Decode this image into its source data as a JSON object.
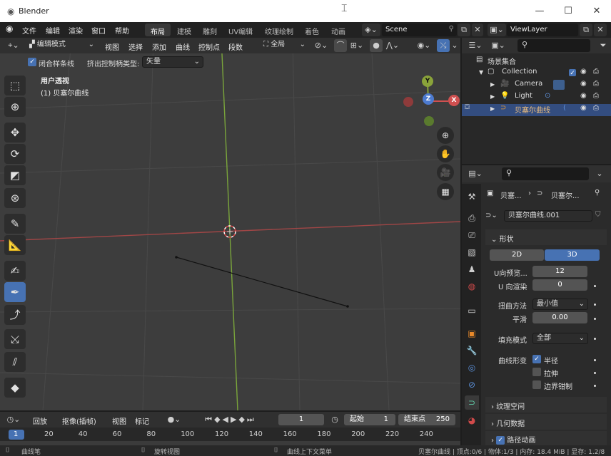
{
  "window": {
    "title": "Blender"
  },
  "menu": {
    "items": [
      "文件",
      "编辑",
      "渲染",
      "窗口",
      "帮助"
    ]
  },
  "workspaces": [
    "布局",
    "建模",
    "雕刻",
    "UV编辑",
    "纹理绘制",
    "着色",
    "动画"
  ],
  "scene": {
    "name": "Scene"
  },
  "viewlayer": {
    "name": "ViewLayer"
  },
  "vpheader": {
    "mode": "编辑模式",
    "menus": [
      "视图",
      "选择",
      "添加",
      "曲线",
      "控制点",
      "段数"
    ],
    "orientation": "全局"
  },
  "vpheader2": {
    "closed_curve": "闭合样条线",
    "extrude_label": "挤出控制柄类型:",
    "extrude_value": "矢量"
  },
  "viewport": {
    "view_name": "用户透视",
    "object_name": "(1) 贝塞尔曲线",
    "gizmo": {
      "x": "X",
      "y": "Y",
      "z": "Z"
    }
  },
  "outliner": {
    "scene_collection": "场景集合",
    "collection": "Collection",
    "items": [
      "Camera",
      "Light",
      "贝塞尔曲线"
    ]
  },
  "properties": {
    "breadcrumb_a": "贝塞...",
    "breadcrumb_b": "贝塞尔...",
    "datablock": "贝塞尔曲线.001",
    "shape_panel": "形状",
    "dim_2d": "2D",
    "dim_3d": "3D",
    "u_preview_label": "U向预览...",
    "u_preview_value": "12",
    "u_render_label": "U 向渲染",
    "u_render_value": "0",
    "twist_label": "扭曲方法",
    "twist_value": "最小值",
    "smooth_label": "平滑",
    "smooth_value": "0.00",
    "fill_label": "填充模式",
    "fill_value": "全部",
    "deform_label": "曲线形变",
    "radius_label": "半径",
    "stretch_label": "拉伸",
    "bounds_label": "边界钳制",
    "panels": [
      "纹理空间",
      "几何数据",
      "路径动画"
    ]
  },
  "timeline": {
    "menus": [
      "回放",
      "抠像(插帧)",
      "视图",
      "标记"
    ],
    "current": "1",
    "start_label": "起始",
    "start": "1",
    "end_label": "结束点",
    "end": "250",
    "ticks": [
      "1",
      "20",
      "40",
      "60",
      "80",
      "100",
      "120",
      "140",
      "160",
      "180",
      "200",
      "220",
      "240"
    ]
  },
  "status": {
    "left": "曲线笔",
    "mid": "旋转视图",
    "right_hint": "曲线上下文菜单",
    "info": "贝塞尔曲线 | 顶点:0/6 | 物体:1/3 | 内存: 18.4 MiB | 显存: 1.2/8"
  }
}
